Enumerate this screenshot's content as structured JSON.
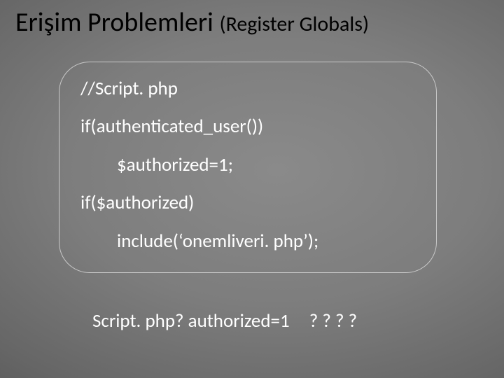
{
  "title": {
    "main": "Erişim Problemleri",
    "sub": "(Register Globals)"
  },
  "code": {
    "l1": "//Script. php",
    "l2": "if(authenticated_user())",
    "l3": "$authorized=1;",
    "l4": "if($authorized)",
    "l5": "include(‘onemliveri. php’);"
  },
  "footer": {
    "text": "Script. php? authorized=1",
    "q": "? ? ? ?"
  }
}
